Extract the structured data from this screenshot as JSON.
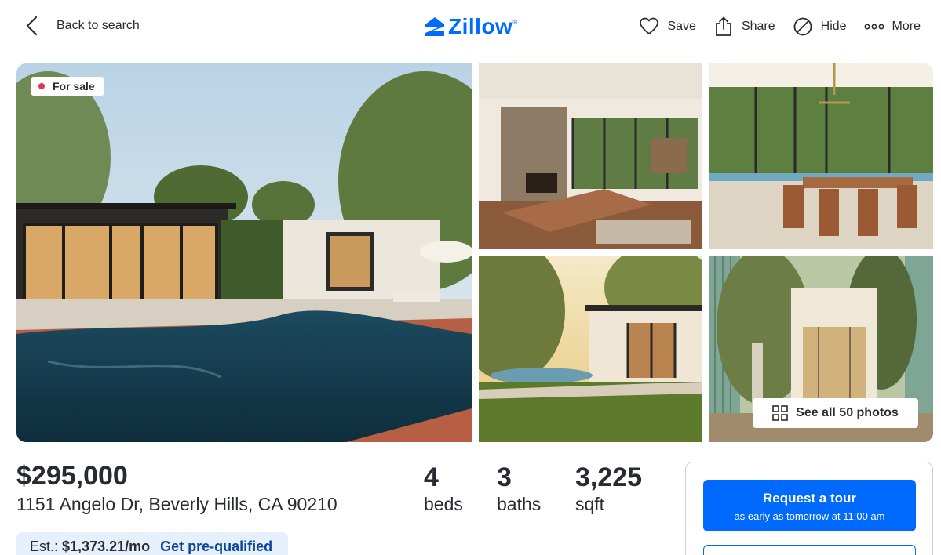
{
  "header": {
    "back_label": "Back to search",
    "logo_text": "Zillow",
    "logo_mark": "®",
    "actions": [
      {
        "icon": "heart-icon",
        "label": "Save"
      },
      {
        "icon": "share-icon",
        "label": "Share"
      },
      {
        "icon": "hide-icon",
        "label": "Hide"
      },
      {
        "icon": "more-icon",
        "label": "More"
      }
    ]
  },
  "gallery": {
    "status_badge": "For sale",
    "see_all_label": "See all 50 photos",
    "photos": [
      "pool-exterior-photo",
      "living-room-photo",
      "dining-room-photo",
      "backyard-sunset-photo",
      "courtyard-photo"
    ]
  },
  "listing": {
    "price": "$295,000",
    "address": "1151 Angelo Dr, Beverly Hills, CA 90210",
    "beds": {
      "value": "4",
      "unit": "beds"
    },
    "baths": {
      "value": "3",
      "unit": "baths"
    },
    "sqft": {
      "value": "3,225",
      "unit": "sqft"
    },
    "estimate_prefix": "Est.:",
    "estimate_amount": "$1,373.21/mo",
    "prequalify_label": "Get pre-qualified"
  },
  "tour": {
    "button_title": "Request a tour",
    "button_subtitle": "as early as tomorrow at 11:00 am"
  },
  "colors": {
    "brand": "#006aff",
    "status_dot": "#e0374b",
    "estimate_bg": "#e6f0fb",
    "link": "#0d4599"
  }
}
